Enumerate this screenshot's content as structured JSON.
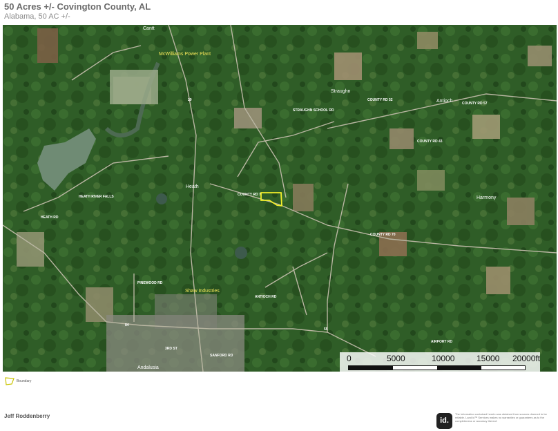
{
  "header": {
    "title": "50 Acres +/- Covington County, AL",
    "subtitle": "Alabama, 50 AC +/-"
  },
  "map": {
    "places": [
      "Cantt",
      "Straughn",
      "Antioch",
      "Heath",
      "Harmony",
      "Andalusia"
    ],
    "points_of_interest": [
      "McWilliams Power Plant",
      "Shaw Industries"
    ],
    "roads": [
      "COUNTY RD 52",
      "COUNTY RD 57",
      "COUNTY RD 70",
      "COUNTY RD 7",
      "COUNTY RD 43",
      "STRAUGHN SCHOOL RD",
      "HEATH RIVER FALLS",
      "HEATH RD",
      "ANTIOCH RD",
      "PINEWOOD RD",
      "SANFORD RD",
      "3RD ST",
      "AIRPORT RD",
      "29",
      "84",
      "55"
    ],
    "boundary_color": "#f2ee2a"
  },
  "scale": {
    "labels": [
      "0",
      "5000",
      "10000",
      "15000",
      "20000ft"
    ]
  },
  "legend": {
    "label": "Boundary",
    "color": "#c9c400"
  },
  "footer": {
    "agent_name": "Jeff Roddenberry",
    "logo_text": "id.",
    "disclaimer": "The information contained herein was obtained from sources deemed to be reliable. Land id™ Services makes no warranties or guarantees as to the completeness or accuracy thereof."
  }
}
